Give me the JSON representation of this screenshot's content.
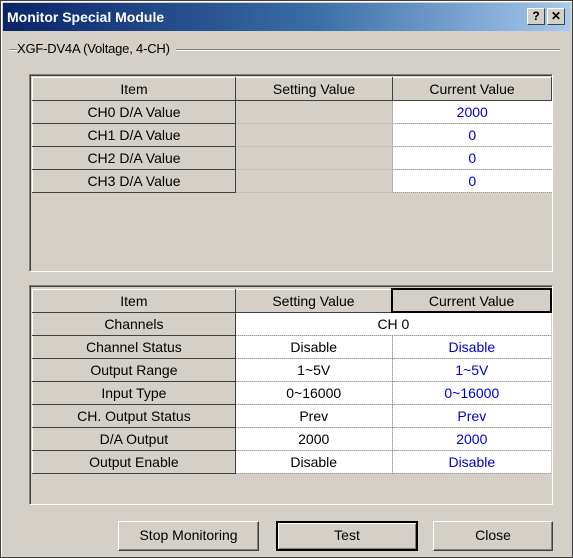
{
  "window": {
    "title": "Monitor Special Module",
    "help_label": "?",
    "close_label": "✕"
  },
  "group": {
    "label": "XGF-DV4A (Voltage, 4-CH)"
  },
  "top_table": {
    "headers": [
      "Item",
      "Setting Value",
      "Current Value"
    ],
    "rows": [
      {
        "item": "CH0 D/A Value",
        "setting": "",
        "current": "2000"
      },
      {
        "item": "CH1 D/A Value",
        "setting": "",
        "current": "0"
      },
      {
        "item": "CH2 D/A Value",
        "setting": "",
        "current": "0"
      },
      {
        "item": "CH3 D/A Value",
        "setting": "",
        "current": "0"
      }
    ]
  },
  "bottom_table": {
    "headers": [
      "Item",
      "Setting Value",
      "Current Value"
    ],
    "channels_row": {
      "item": "Channels",
      "value": "CH 0"
    },
    "rows": [
      {
        "item": "Channel Status",
        "setting": "Disable",
        "current": "Disable"
      },
      {
        "item": "Output Range",
        "setting": "1~5V",
        "current": "1~5V"
      },
      {
        "item": "Input Type",
        "setting": "0~16000",
        "current": "0~16000"
      },
      {
        "item": "CH. Output Status",
        "setting": "Prev",
        "current": "Prev"
      },
      {
        "item": "D/A Output",
        "setting": "2000",
        "current": "2000"
      },
      {
        "item": "Output Enable",
        "setting": "Disable",
        "current": "Disable"
      }
    ]
  },
  "buttons": {
    "stop_monitoring": "Stop Monitoring",
    "test": "Test",
    "close": "Close"
  },
  "colors": {
    "current_value_text": "#0000cc",
    "title_gradient_start": "#0a246a",
    "title_gradient_end": "#a6caf0"
  }
}
